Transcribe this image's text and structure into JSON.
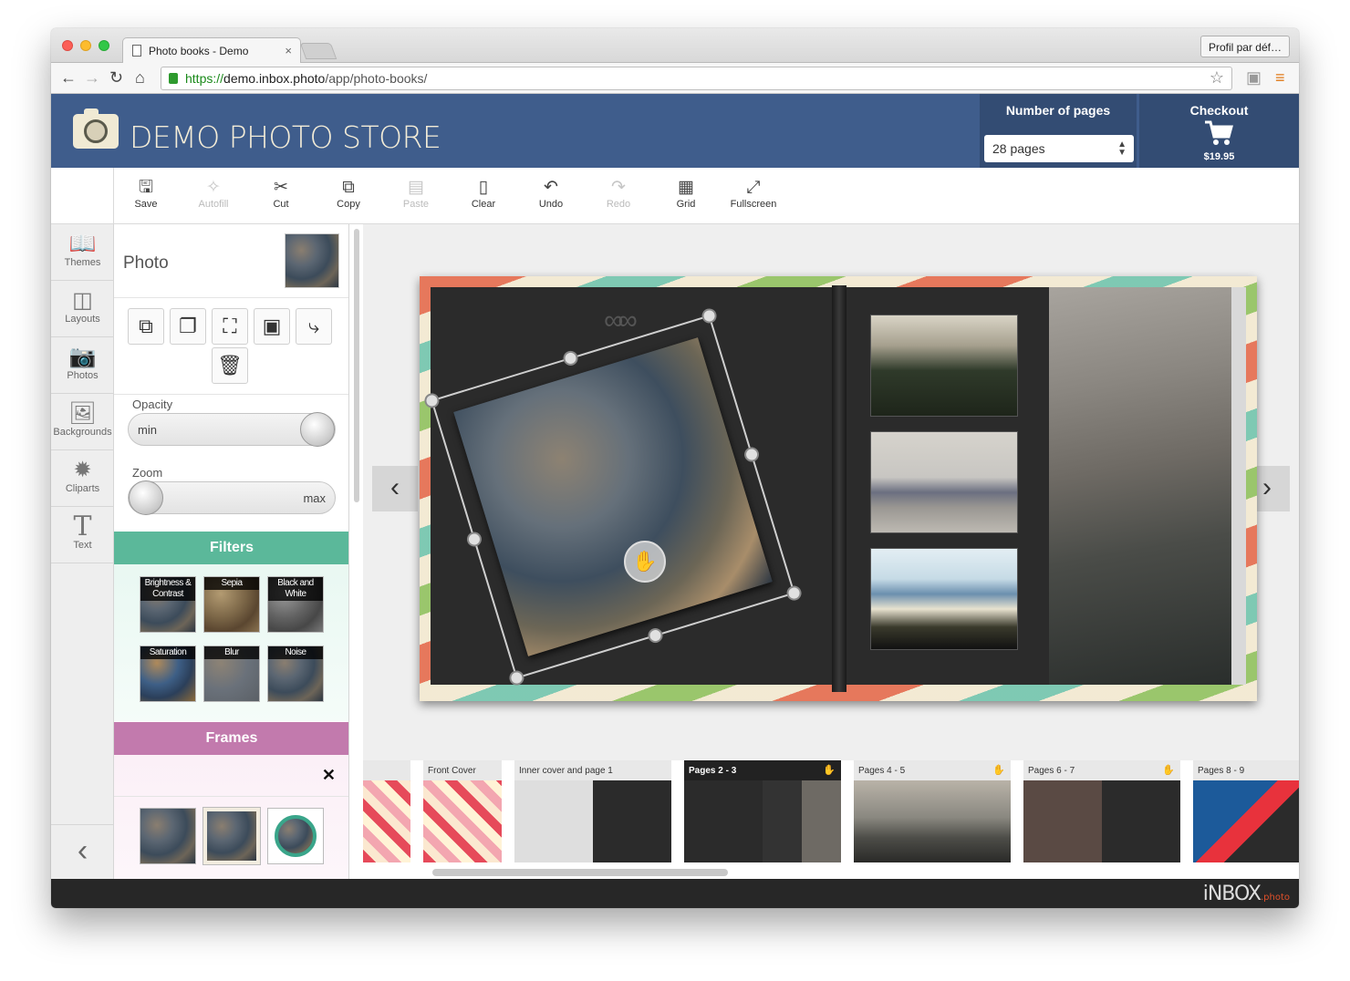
{
  "browser": {
    "tab_title": "Photo books - Demo",
    "tab_close": "×",
    "profile": "Profil par déf…",
    "url_scheme": "https://",
    "url_host": "demo.inbox.photo",
    "url_path": "/app/photo-books/"
  },
  "header": {
    "store_name": "DEMO PHOTO STORE",
    "pages_label": "Number of pages",
    "pages_value": "28 pages",
    "checkout_label": "Checkout",
    "checkout_price": "$19.95"
  },
  "toolbar": {
    "save": "Save",
    "autofill": "Autofill",
    "cut": "Cut",
    "copy": "Copy",
    "paste": "Paste",
    "clear": "Clear",
    "undo": "Undo",
    "redo": "Redo",
    "grid": "Grid",
    "fullscreen": "Fullscreen"
  },
  "sidebar": {
    "themes": "Themes",
    "layouts": "Layouts",
    "photos": "Photos",
    "backgrounds": "Backgrounds",
    "cliparts": "Cliparts",
    "text": "Text"
  },
  "panel": {
    "title": "Photo",
    "opacity_label": "Opacity",
    "opacity_value": "min",
    "zoom_label": "Zoom",
    "zoom_value": "max",
    "filters_title": "Filters",
    "frames_title": "Frames",
    "frames_close": "✕",
    "filters": {
      "brightness_1": "Brightness &",
      "brightness_2": "Contrast",
      "sepia": "Sepia",
      "bw_1": "Black and",
      "bw_2": "White",
      "saturation": "Saturation",
      "blur": "Blur",
      "noise": "Noise"
    }
  },
  "pages_strip": {
    "front_cover": "Front Cover",
    "inner_cover": "Inner cover and page 1",
    "pages_2_3": "Pages 2 - 3",
    "pages_4_5": "Pages 4 - 5",
    "pages_6_7": "Pages 6 - 7",
    "pages_8_9": "Pages 8 - 9"
  },
  "footer": {
    "brand": "iNBOX",
    "brand_suffix": ".photo"
  },
  "colors": {
    "header_blue": "#3f5d8c",
    "filters_green": "#5bb89a",
    "frames_pink": "#c27aad"
  }
}
